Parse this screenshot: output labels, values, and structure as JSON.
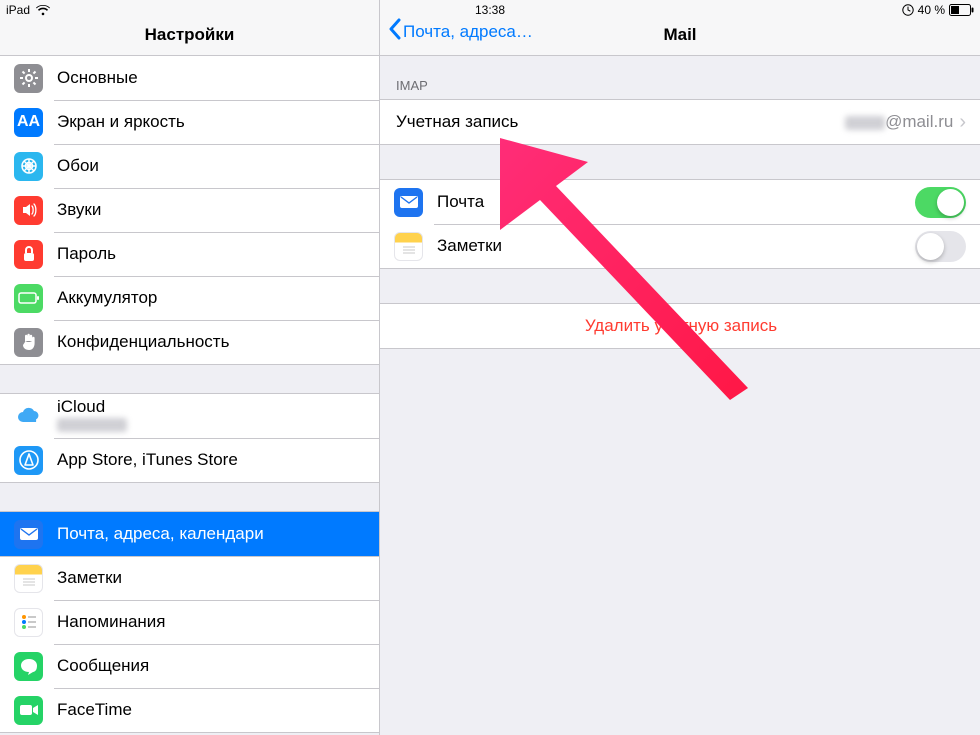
{
  "statusbar": {
    "device": "iPad",
    "time": "13:38",
    "battery_pct": "40 %"
  },
  "sidebar": {
    "title": "Настройки",
    "groups": [
      {
        "rows": [
          {
            "id": "general",
            "label": "Основные",
            "icon": "gear"
          },
          {
            "id": "display",
            "label": "Экран и яркость",
            "icon": "display"
          },
          {
            "id": "wall",
            "label": "Обои",
            "icon": "wall"
          },
          {
            "id": "sound",
            "label": "Звуки",
            "icon": "sound"
          },
          {
            "id": "pass",
            "label": "Пароль",
            "icon": "pass"
          },
          {
            "id": "batt",
            "label": "Аккумулятор",
            "icon": "batt"
          },
          {
            "id": "privacy",
            "label": "Конфиденциальность",
            "icon": "privacy"
          }
        ]
      },
      {
        "rows": [
          {
            "id": "icloud",
            "label": "iCloud",
            "icon": "icloud",
            "sub_blur": true
          },
          {
            "id": "appstore",
            "label": "App Store, iTunes Store",
            "icon": "appstore"
          }
        ]
      },
      {
        "rows": [
          {
            "id": "mail",
            "label": "Почта, адреса, календари",
            "icon": "mail",
            "selected": true
          },
          {
            "id": "notes",
            "label": "Заметки",
            "icon": "notes"
          },
          {
            "id": "remind",
            "label": "Напоминания",
            "icon": "remind"
          },
          {
            "id": "msg",
            "label": "Сообщения",
            "icon": "msg"
          },
          {
            "id": "facetime",
            "label": "FaceTime",
            "icon": "facetime"
          }
        ]
      }
    ]
  },
  "detail": {
    "back_label": "Почта, адреса…",
    "title": "Mail",
    "sections": {
      "imap_header": "IMAP",
      "account_label": "Учетная запись",
      "account_value": "@mail.ru",
      "services": [
        {
          "id": "svc-mail",
          "label": "Почта",
          "icon": "mail",
          "on": true
        },
        {
          "id": "svc-notes",
          "label": "Заметки",
          "icon": "notes",
          "on": false
        }
      ],
      "delete_label": "Удалить учетную запись"
    }
  }
}
